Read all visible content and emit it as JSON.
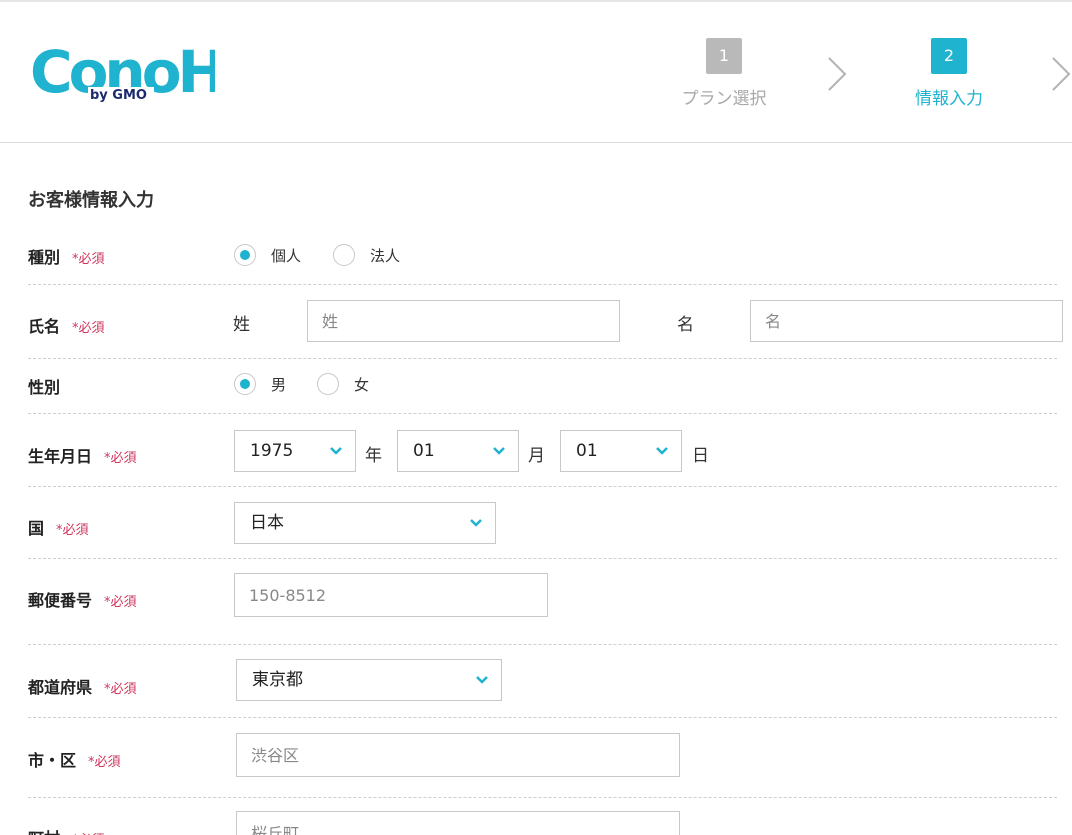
{
  "header": {
    "logo_text": "ConoHa",
    "logo_sub": "by GMO",
    "steps": [
      {
        "num": "1",
        "label": "プラン選択"
      },
      {
        "num": "2",
        "label": "情報入力"
      }
    ]
  },
  "form": {
    "title": "お客様情報入力",
    "required_mark": "*必須",
    "type": {
      "label": "種別",
      "options": [
        "個人",
        "法人"
      ],
      "selected": "個人"
    },
    "name": {
      "label": "氏名",
      "last_label": "姓",
      "last_placeholder": "姓",
      "first_label": "名",
      "first_placeholder": "名"
    },
    "gender": {
      "label": "性別",
      "options": [
        "男",
        "女"
      ],
      "selected": "男"
    },
    "birthday": {
      "label": "生年月日",
      "year": "1975",
      "year_unit": "年",
      "month": "01",
      "month_unit": "月",
      "day": "01",
      "day_unit": "日"
    },
    "country": {
      "label": "国",
      "value": "日本"
    },
    "postal": {
      "label": "郵便番号",
      "placeholder": "150-8512"
    },
    "prefecture": {
      "label": "都道府県",
      "value": "東京都"
    },
    "city": {
      "label": "市・区",
      "placeholder": "渋谷区"
    },
    "town": {
      "label": "町村",
      "placeholder": "桜丘町"
    }
  },
  "colors": {
    "accent": "#1fb3cf",
    "required": "#d0345c"
  }
}
